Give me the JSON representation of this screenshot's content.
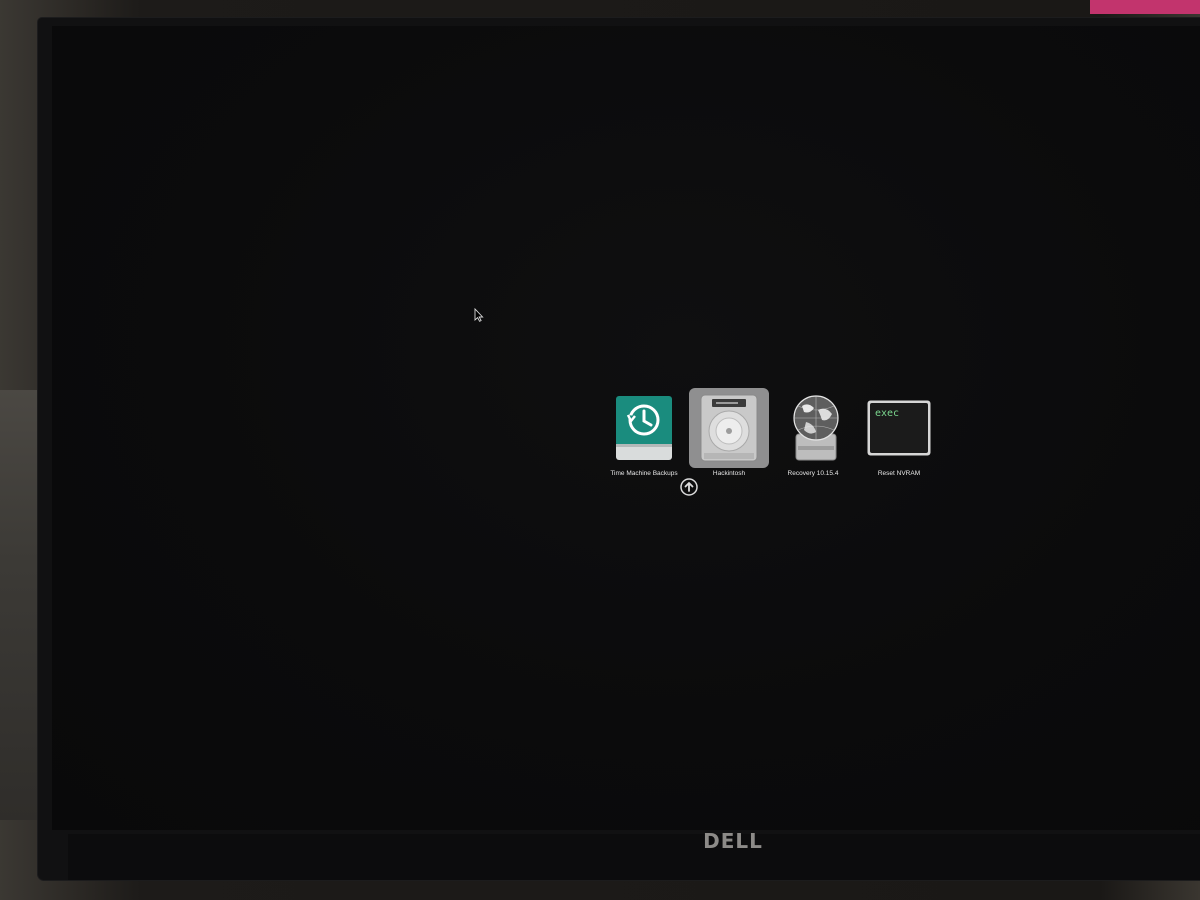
{
  "boot_picker": {
    "entries": [
      {
        "label": "Time Machine Backups",
        "icon": "time-machine-drive-icon",
        "selected": false
      },
      {
        "label": "Hackintosh",
        "icon": "hard-drive-icon",
        "selected": true
      },
      {
        "label": "Recovery 10.15.4",
        "icon": "recovery-globe-icon",
        "selected": false
      },
      {
        "label": "Reset NVRAM",
        "icon": "exec-terminal-icon",
        "selected": false,
        "icon_text": "exec"
      }
    ]
  },
  "monitor": {
    "brand": "DELL"
  },
  "colors": {
    "time_machine_teal": "#1a8c7e",
    "exec_text_green": "#7bd88f",
    "selection_highlight": "#8f8f90"
  }
}
